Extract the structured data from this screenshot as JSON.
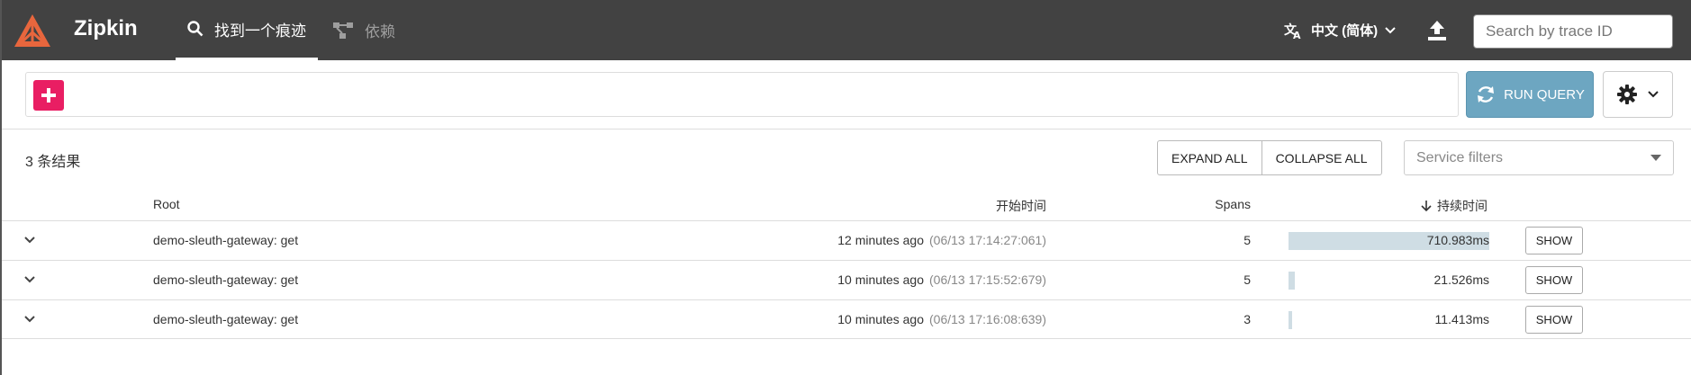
{
  "header": {
    "brand": "Zipkin",
    "tabs": [
      {
        "label": "找到一个痕迹",
        "active": true
      },
      {
        "label": "依赖",
        "active": false
      }
    ],
    "language": "中文 (简体)",
    "search_placeholder": "Search by trace ID"
  },
  "query": {
    "run_label": "RUN QUERY"
  },
  "results": {
    "count_label": "3 条结果",
    "expand_all": "EXPAND ALL",
    "collapse_all": "COLLAPSE ALL",
    "service_filter_placeholder": "Service filters"
  },
  "table": {
    "columns": {
      "root": "Root",
      "start_time": "开始时间",
      "spans": "Spans",
      "duration": "持续时间"
    },
    "rows": [
      {
        "root": "demo-sleuth-gateway: get",
        "relative": "12 minutes ago",
        "timestamp": "(06/13 17:14:27:061)",
        "spans": "5",
        "duration": "710.983ms",
        "duration_fraction": 1.0,
        "show": "SHOW"
      },
      {
        "root": "demo-sleuth-gateway: get",
        "relative": "10 minutes ago",
        "timestamp": "(06/13 17:15:52:679)",
        "spans": "5",
        "duration": "21.526ms",
        "duration_fraction": 0.0303,
        "show": "SHOW"
      },
      {
        "root": "demo-sleuth-gateway: get",
        "relative": "10 minutes ago",
        "timestamp": "(06/13 17:16:08:639)",
        "spans": "3",
        "duration": "11.413ms",
        "duration_fraction": 0.0161,
        "show": "SHOW"
      }
    ]
  },
  "colors": {
    "header_bg": "#424242",
    "logo": "#e8663d",
    "add_button": "#e91e63",
    "run_button": "#6da6c1",
    "duration_bar": "#cfdde4"
  }
}
